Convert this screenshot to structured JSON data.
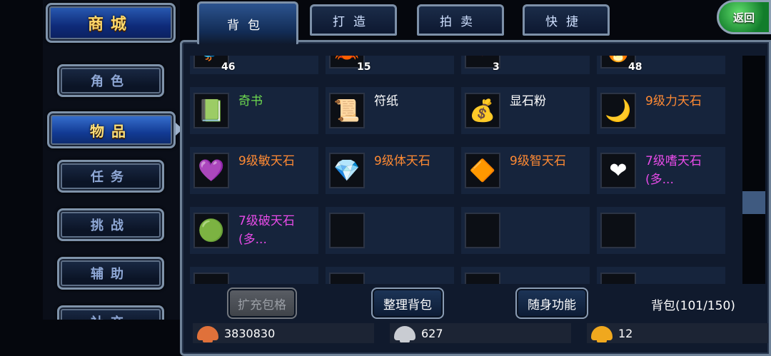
{
  "nav": {
    "shop": "商城",
    "items": [
      {
        "label": "角色",
        "name": "role"
      },
      {
        "label": "物品",
        "name": "items",
        "active": true
      },
      {
        "label": "任务",
        "name": "quests"
      },
      {
        "label": "挑战",
        "name": "challenge"
      },
      {
        "label": "辅助",
        "name": "assist"
      },
      {
        "label": "社交",
        "name": "social"
      }
    ]
  },
  "tabs": [
    {
      "label": "背包",
      "active": true
    },
    {
      "label": "打造"
    },
    {
      "label": "拍卖"
    },
    {
      "label": "快捷"
    }
  ],
  "back": "返回",
  "partial_row": [
    {
      "count": "46",
      "icon": "bird-icon",
      "glyph": "🐦"
    },
    {
      "count": "15",
      "icon": "crab-icon",
      "glyph": "🦀"
    },
    {
      "count": "3",
      "icon": "heart-gem-icon",
      "glyph": "❤"
    },
    {
      "count": "48",
      "icon": "fire-orb-icon",
      "glyph": "🔥"
    }
  ],
  "items": [
    {
      "name": "奇书",
      "color": "#6fdc4f",
      "icon": "book-icon",
      "glyph": "📗"
    },
    {
      "name": "符纸",
      "color": "#ffffff",
      "icon": "talisman-icon",
      "glyph": "📜"
    },
    {
      "name": "显石粉",
      "color": "#ffffff",
      "icon": "powder-bag-icon",
      "glyph": "💰"
    },
    {
      "name": "9级力天石",
      "color": "#ff8a33",
      "icon": "moon-star-icon",
      "glyph": "🌙"
    },
    {
      "name": "9级敏天石",
      "color": "#ff8a33",
      "icon": "purple-crystal-icon",
      "glyph": "💜"
    },
    {
      "name": "9级体天石",
      "color": "#ff8a33",
      "icon": "blue-diamond-icon",
      "glyph": "💎"
    },
    {
      "name": "9级智天石",
      "color": "#ff8a33",
      "icon": "orange-hexagon-icon",
      "glyph": "🔶"
    },
    {
      "name": "7级嗜天石(多...",
      "color": "#e84be8",
      "icon": "red-heart-icon",
      "glyph": "❤"
    },
    {
      "name": "7级破天石(多...",
      "color": "#e84be8",
      "icon": "green-orb-icon",
      "glyph": "🟢"
    },
    {
      "name": "",
      "color": "#ffffff",
      "icon": "empty-slot-icon",
      "glyph": ""
    },
    {
      "name": "",
      "color": "#ffffff",
      "icon": "empty-slot-icon",
      "glyph": ""
    },
    {
      "name": "",
      "color": "#ffffff",
      "icon": "empty-slot-icon",
      "glyph": ""
    }
  ],
  "buttons": {
    "expand": "扩充包格",
    "sort": "整理背包",
    "portable": "随身功能"
  },
  "bag_count": "背包(101/150)",
  "currency": [
    {
      "value": "3830830",
      "icon": "copper-shell-icon",
      "color": "#e0713a"
    },
    {
      "value": "627",
      "icon": "silver-shell-icon",
      "color": "#c9ccd2"
    },
    {
      "value": "12",
      "icon": "gold-shell-icon",
      "color": "#f0a81e"
    }
  ]
}
